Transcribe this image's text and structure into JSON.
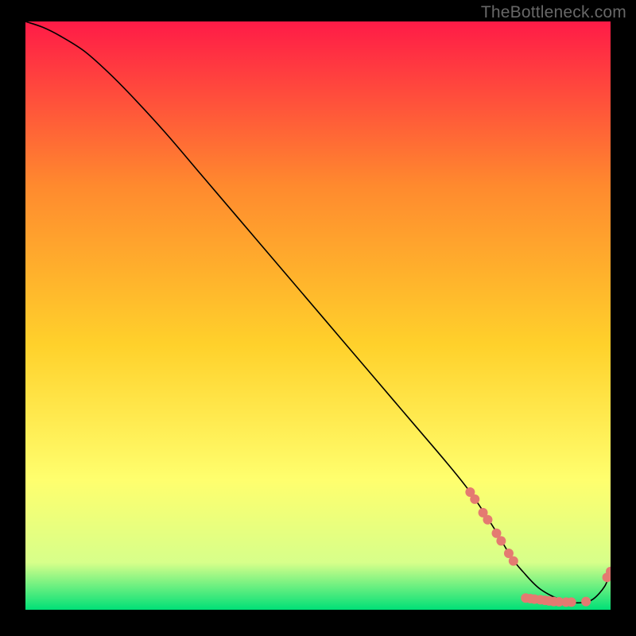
{
  "watermark": "TheBottleneck.com",
  "chart_data": {
    "type": "line",
    "title": "",
    "xlabel": "",
    "ylabel": "",
    "xlim": [
      0,
      100
    ],
    "ylim": [
      0,
      100
    ],
    "grid": false,
    "legend": false,
    "background_gradient": {
      "top": "#ff1b47",
      "upper_mid": "#ff8a2e",
      "mid": "#ffd12b",
      "lower_mid": "#ffff6e",
      "near_bottom": "#d7ff8a",
      "bottom": "#00e077"
    },
    "series": [
      {
        "name": "bottleneck-curve",
        "color": "#000000",
        "stroke_width": 1.6,
        "x": [
          0,
          3,
          6,
          10,
          14,
          18,
          24,
          30,
          36,
          42,
          48,
          54,
          60,
          66,
          72,
          76,
          80,
          83,
          85,
          88,
          92,
          95,
          97,
          99,
          100
        ],
        "y": [
          100,
          99,
          97.5,
          95,
          91.5,
          87.5,
          81,
          74,
          67,
          60,
          53,
          46,
          39,
          32,
          25,
          20,
          14,
          9,
          6.5,
          3.5,
          1.5,
          1.2,
          1.8,
          4.0,
          6.5
        ]
      }
    ],
    "markers": {
      "note": "Dense salmon dots along the curve in the lower-right quadrant",
      "shape": "circle",
      "color": "#e47a71",
      "radius_px": 6,
      "points": [
        {
          "x": 76.0,
          "y": 20.0
        },
        {
          "x": 76.8,
          "y": 18.8
        },
        {
          "x": 78.2,
          "y": 16.5
        },
        {
          "x": 79.0,
          "y": 15.3
        },
        {
          "x": 80.5,
          "y": 13.0
        },
        {
          "x": 81.3,
          "y": 11.7
        },
        {
          "x": 82.6,
          "y": 9.6
        },
        {
          "x": 83.4,
          "y": 8.3
        },
        {
          "x": 85.5,
          "y": 2.0
        },
        {
          "x": 86.3,
          "y": 1.9
        },
        {
          "x": 87.0,
          "y": 1.8
        },
        {
          "x": 88.0,
          "y": 1.7
        },
        {
          "x": 88.8,
          "y": 1.6
        },
        {
          "x": 89.5,
          "y": 1.5
        },
        {
          "x": 90.3,
          "y": 1.4
        },
        {
          "x": 91.2,
          "y": 1.35
        },
        {
          "x": 92.4,
          "y": 1.3
        },
        {
          "x": 93.3,
          "y": 1.3
        },
        {
          "x": 95.8,
          "y": 1.4
        },
        {
          "x": 99.4,
          "y": 5.5
        },
        {
          "x": 100.0,
          "y": 6.5
        }
      ]
    }
  }
}
